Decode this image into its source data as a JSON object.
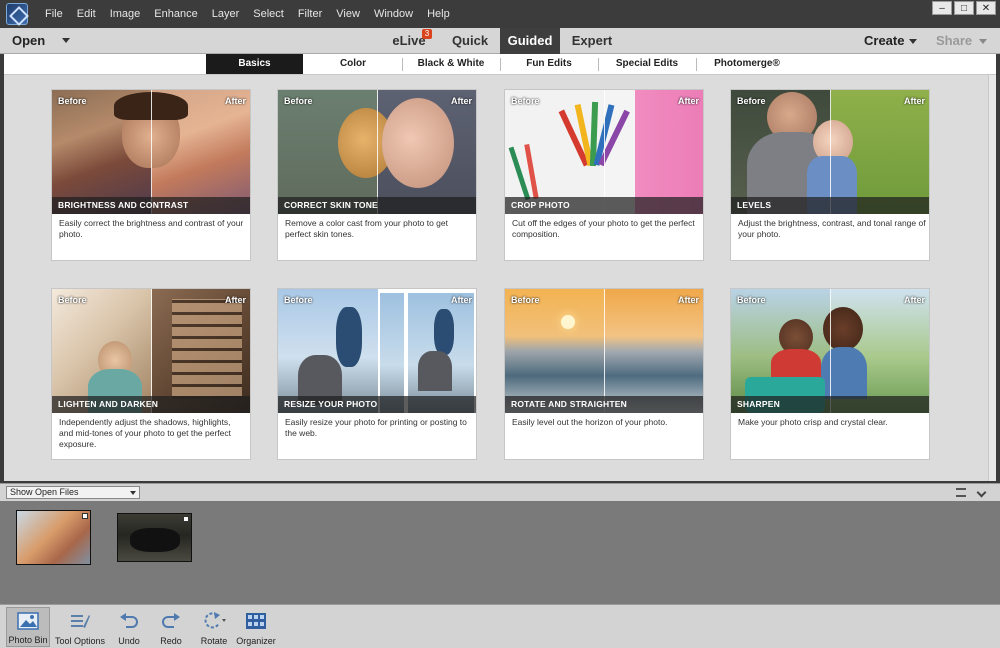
{
  "menu": [
    "File",
    "Edit",
    "Image",
    "Enhance",
    "Layer",
    "Select",
    "Filter",
    "View",
    "Window",
    "Help"
  ],
  "window_controls": {
    "minimize": "–",
    "restore": "□",
    "close": "✕"
  },
  "modebar": {
    "open": "Open",
    "elive": "eLive",
    "elive_badge": "3",
    "quick": "Quick",
    "guided": "Guided",
    "expert": "Expert",
    "create": "Create",
    "share": "Share"
  },
  "categories": [
    "Basics",
    "Color",
    "Black & White",
    "Fun Edits",
    "Special Edits",
    "Photomerge®"
  ],
  "cards": [
    {
      "title": "BRIGHTNESS AND CONTRAST",
      "desc": "Easily correct the brightness and contrast of your photo.",
      "before": "Before",
      "after": "After"
    },
    {
      "title": "CORRECT SKIN TONE",
      "desc": "Remove a color cast from your photo to get perfect skin tones.",
      "before": "Before",
      "after": "After"
    },
    {
      "title": "CROP PHOTO",
      "desc": "Cut off the edges of your photo to get the perfect composition.",
      "before": "Before",
      "after": "After"
    },
    {
      "title": "LEVELS",
      "desc": "Adjust the brightness, contrast, and tonal range of your photo.",
      "before": "Before",
      "after": "After"
    },
    {
      "title": "LIGHTEN AND DARKEN",
      "desc": "Independently adjust the shadows, highlights, and mid-tones of your photo to get the perfect exposure.",
      "before": "Before",
      "after": "After"
    },
    {
      "title": "RESIZE YOUR PHOTO",
      "desc": "Easily resize your photo for printing or posting to the web.",
      "before": "Before",
      "after": "After"
    },
    {
      "title": "ROTATE AND STRAIGHTEN",
      "desc": "Easily level out the horizon of your photo.",
      "before": "Before",
      "after": "After"
    },
    {
      "title": "SHARPEN",
      "desc": "Make your photo crisp and crystal clear.",
      "before": "Before",
      "after": "After"
    }
  ],
  "photo_bin": {
    "selector": "Show Open Files"
  },
  "toolbar": {
    "photo_bin": "Photo Bin",
    "tool_options": "Tool Options",
    "undo": "Undo",
    "redo": "Redo",
    "rotate": "Rotate",
    "organizer": "Organizer"
  },
  "colors": {
    "accent_badge": "#d9431d",
    "active_tab": "#1b1b1b",
    "mode_active": "#3e3e3e"
  }
}
